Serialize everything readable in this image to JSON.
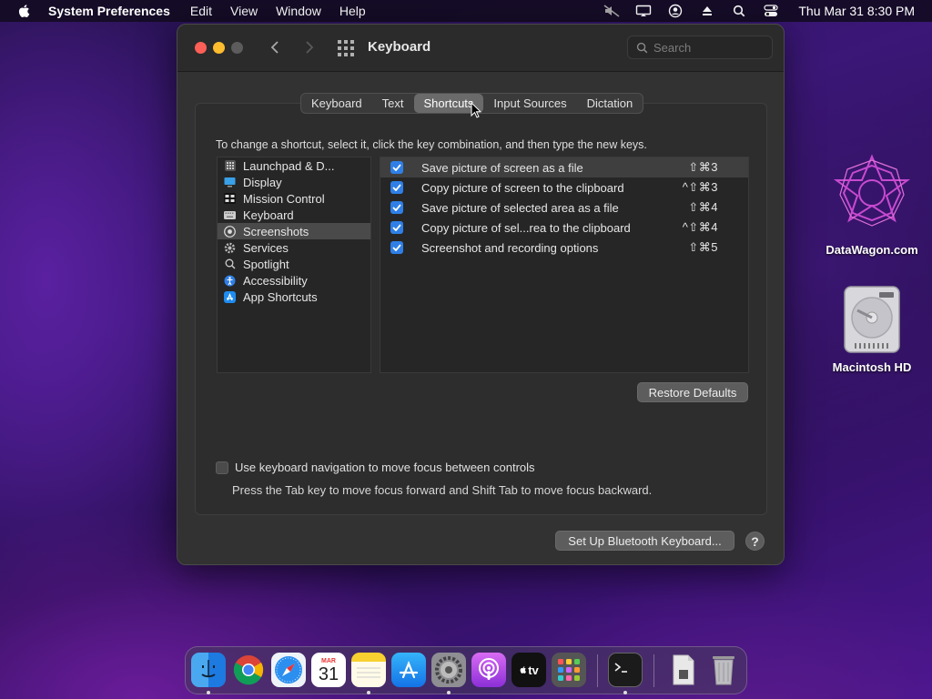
{
  "menubar": {
    "app_name": "System Preferences",
    "items": [
      "Edit",
      "View",
      "Window",
      "Help"
    ],
    "clock": "Thu Mar 31  8:30 PM"
  },
  "desktop": {
    "icons": [
      {
        "label": "DataWagon.com"
      },
      {
        "label": "Macintosh HD"
      }
    ]
  },
  "window": {
    "title": "Keyboard",
    "search_placeholder": "Search",
    "tabs": [
      "Keyboard",
      "Text",
      "Shortcuts",
      "Input Sources",
      "Dictation"
    ],
    "active_tab": "Shortcuts",
    "instructions": "To change a shortcut, select it, click the key combination, and then type the new keys.",
    "categories": [
      {
        "label": "Launchpad & D...",
        "icon": "launchpad-icon"
      },
      {
        "label": "Display",
        "icon": "display-icon"
      },
      {
        "label": "Mission Control",
        "icon": "mission-control-icon"
      },
      {
        "label": "Keyboard",
        "icon": "keyboard-icon"
      },
      {
        "label": "Screenshots",
        "icon": "screenshots-icon"
      },
      {
        "label": "Services",
        "icon": "gear-icon"
      },
      {
        "label": "Spotlight",
        "icon": "spotlight-icon"
      },
      {
        "label": "Accessibility",
        "icon": "accessibility-icon"
      },
      {
        "label": "App Shortcuts",
        "icon": "app-store-icon"
      }
    ],
    "selected_category": "Screenshots",
    "shortcuts": [
      {
        "label": "Save picture of screen as a file",
        "keys": "⇧⌘3",
        "checked": true
      },
      {
        "label": "Copy picture of screen to the clipboard",
        "keys": "^⇧⌘3",
        "checked": true
      },
      {
        "label": "Save picture of selected area as a file",
        "keys": "⇧⌘4",
        "checked": true
      },
      {
        "label": "Copy picture of sel...rea to the clipboard",
        "keys": "^⇧⌘4",
        "checked": true
      },
      {
        "label": "Screenshot and recording options",
        "keys": "⇧⌘5",
        "checked": true
      }
    ],
    "restore_label": "Restore Defaults",
    "kb_nav_label": "Use keyboard navigation to move focus between controls",
    "kb_nav_note": "Press the Tab key to move focus forward and Shift Tab to move focus backward.",
    "bluetooth_label": "Set Up Bluetooth Keyboard...",
    "help_label": "?"
  },
  "dock": {
    "calendar_month": "MAR",
    "calendar_day": "31",
    "tv_label": "tv"
  },
  "colors": {
    "accent": "#2f7fe7",
    "close": "#fe5f57",
    "minimize": "#febc2e"
  }
}
